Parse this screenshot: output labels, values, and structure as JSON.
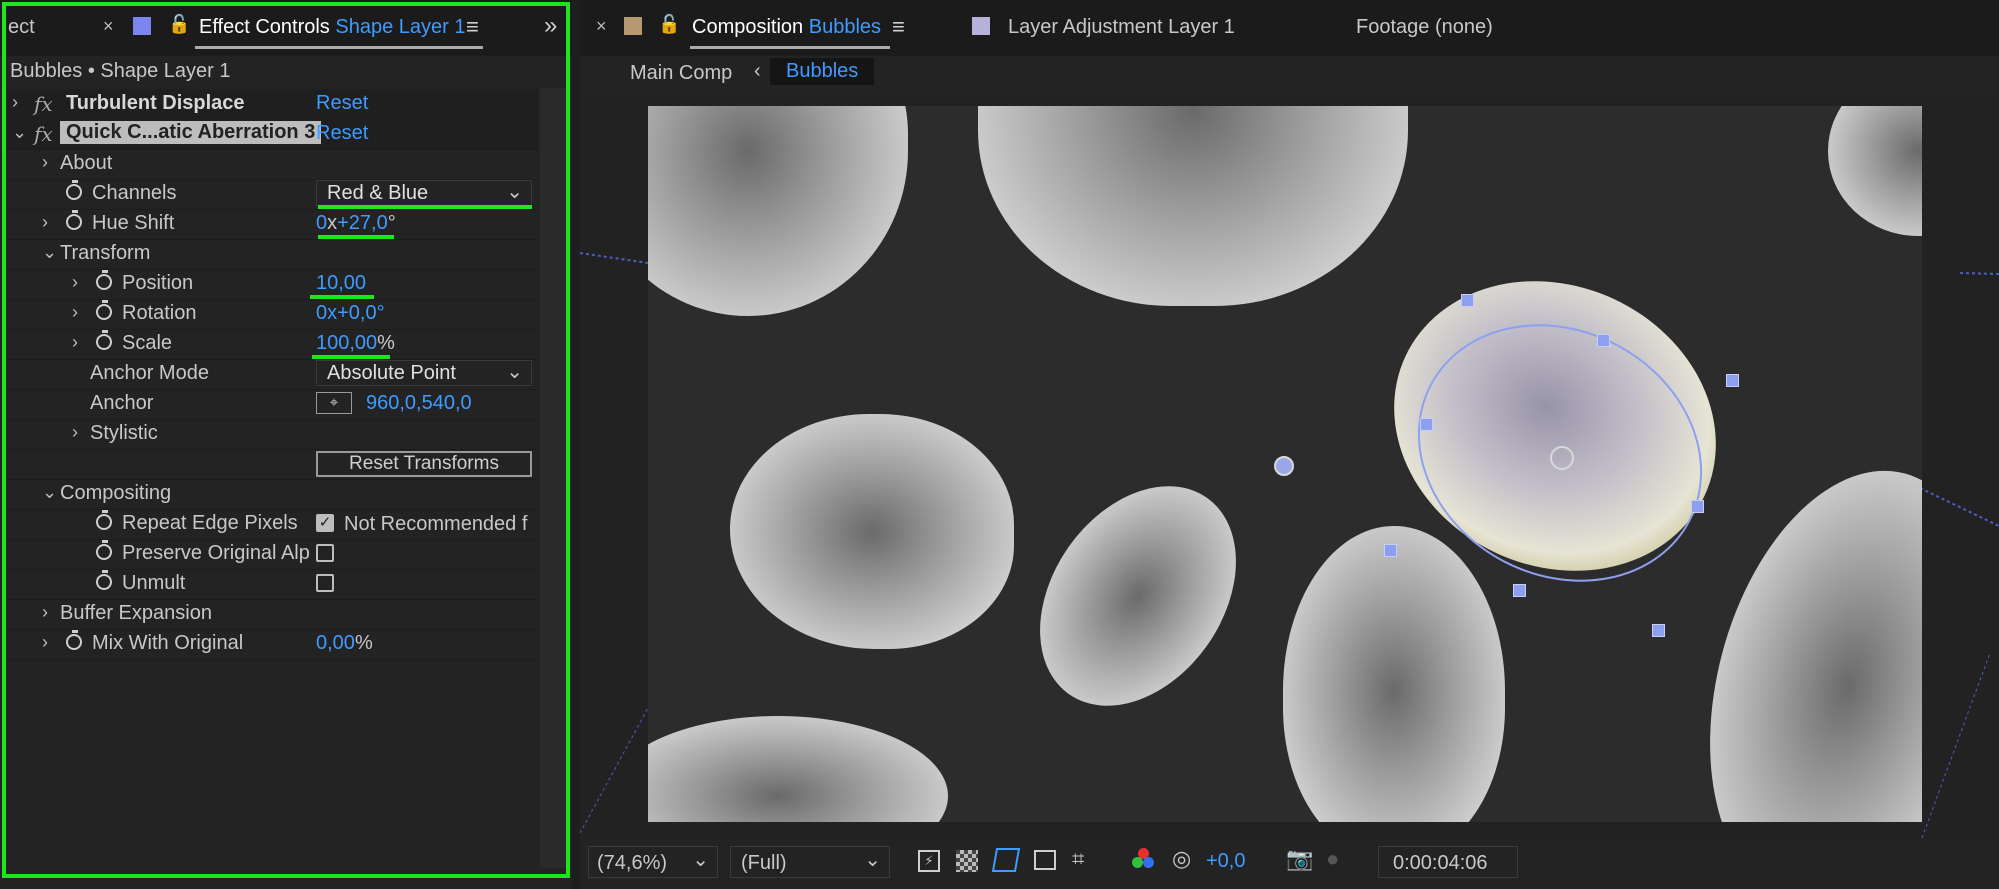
{
  "left_panel": {
    "tab_prev": "ect",
    "tab_title": "Effect Controls",
    "tab_layer": "Shape Layer 1",
    "breadcrumb": "Bubbles • Shape Layer 1",
    "effects": [
      {
        "name": "Turbulent Displace",
        "reset": "Reset"
      },
      {
        "name": "Quick C...atic Aberration 3",
        "reset": "Reset"
      }
    ],
    "props": {
      "about": "About",
      "channels": "Channels",
      "channels_value": "Red & Blue",
      "hue_shift": "Hue Shift",
      "hue_shift_a": "0",
      "hue_shift_b": "x",
      "hue_shift_c": "+27,0",
      "hue_shift_d": "°",
      "transform": "Transform",
      "position": "Position",
      "position_value": "10,00",
      "rotation": "Rotation",
      "rotation_value": "0x+0,0°",
      "scale": "Scale",
      "scale_value": "100,00",
      "scale_unit": "%",
      "anchor_mode": "Anchor Mode",
      "anchor_mode_value": "Absolute Point",
      "anchor": "Anchor",
      "anchor_value": "960,0,540,0",
      "stylistic": "Stylistic",
      "reset_transforms": "Reset Transforms",
      "compositing": "Compositing",
      "repeat_edge": "Repeat Edge Pixels",
      "repeat_edge_checked": true,
      "repeat_edge_note": "Not Recommended f",
      "preserve_alpha": "Preserve Original Alp",
      "unmult": "Unmult",
      "buffer_expansion": "Buffer Expansion",
      "mix": "Mix With Original",
      "mix_value": "0,00",
      "mix_unit": "%"
    }
  },
  "right_panel": {
    "tab_comp_label": "Composition",
    "tab_comp_name": "Bubbles",
    "tab_layer": "Layer Adjustment Layer 1",
    "tab_footage": "Footage (none)",
    "crumb_main": "Main Comp",
    "crumb_current": "Bubbles",
    "toolbar": {
      "zoom": "(74,6%)",
      "resolution": "(Full)",
      "exposure": "+0,0",
      "timecode": "0:00:04:06"
    }
  },
  "colors": {
    "accent_blue": "#3e9bff",
    "highlight_green": "#1ee61e",
    "panel_bg": "#232323"
  }
}
